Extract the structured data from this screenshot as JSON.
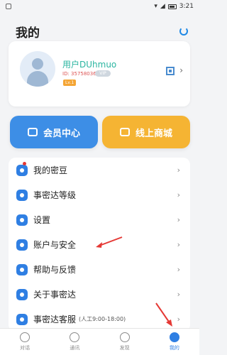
{
  "status": {
    "time": "3:21"
  },
  "header": {
    "title": "我的"
  },
  "profile": {
    "username": "用户DUhmuo",
    "user_id": "ID: 357580369",
    "vip": "VIP",
    "level": "Lv.1"
  },
  "buttons": {
    "member": "会员中心",
    "mall": "线上商城"
  },
  "menu": {
    "beans": "我的密豆",
    "level": "事密达等级",
    "settings": "设置",
    "account": "账户与安全",
    "help": "帮助与反馈",
    "about": "关于事密达",
    "service": "事密达客服",
    "service_hours": "(人工9:00-18:00)"
  },
  "tabs": [
    {
      "label": "对话",
      "icon": "chat-icon"
    },
    {
      "label": "通讯",
      "icon": "contacts-icon"
    },
    {
      "label": "发现",
      "icon": "compass-icon"
    },
    {
      "label": "我的",
      "icon": "profile-icon"
    }
  ],
  "colors": {
    "accent": "#2f7fe3",
    "teal": "#2ab5a0",
    "mall": "#f5b433",
    "member": "#3d8ee6",
    "arrow": "#e53935"
  }
}
